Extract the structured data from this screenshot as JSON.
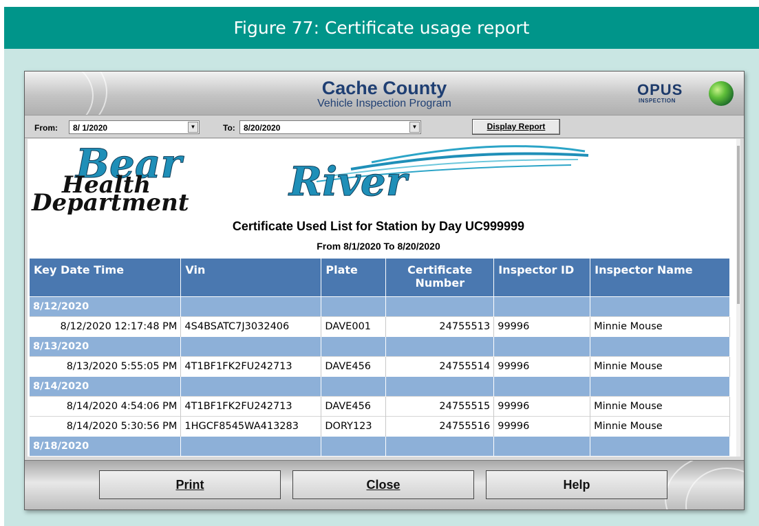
{
  "figure": {
    "caption": "Figure 77: Certificate usage report"
  },
  "window": {
    "title": "Cache County",
    "subtitle": "Vehicle Inspection Program",
    "brand": {
      "name": "OPUS",
      "tagline": "INSPECTION"
    }
  },
  "filters": {
    "from_label": "From:",
    "from_value": "8/ 1/2020",
    "to_label": "To:",
    "to_value": "8/20/2020",
    "display_button": "Display Report"
  },
  "report": {
    "logo": {
      "line1": "Bear",
      "line2": "River",
      "line3": "Health",
      "line4": "Department"
    },
    "title": "Certificate Used List for Station by Day UC999999",
    "range": "From 8/1/2020 To 8/20/2020",
    "columns": [
      "Key Date Time",
      "Vin",
      "Plate",
      "Certificate Number",
      "Inspector ID",
      "Inspector Name"
    ],
    "rows": [
      {
        "type": "group",
        "date": "8/12/2020"
      },
      {
        "type": "data",
        "datetime": "8/12/2020 12:17:48 PM",
        "vin": "4S4BSATC7J3032406",
        "plate": "DAVE001",
        "cert": "24755513",
        "inspector_id": "99996",
        "inspector_name": "Minnie Mouse"
      },
      {
        "type": "group",
        "date": "8/13/2020"
      },
      {
        "type": "data",
        "datetime": "8/13/2020 5:55:05 PM",
        "vin": "4T1BF1FK2FU242713",
        "plate": "DAVE456",
        "cert": "24755514",
        "inspector_id": "99996",
        "inspector_name": "Minnie Mouse"
      },
      {
        "type": "group",
        "date": "8/14/2020"
      },
      {
        "type": "data",
        "datetime": "8/14/2020 4:54:06 PM",
        "vin": "4T1BF1FK2FU242713",
        "plate": "DAVE456",
        "cert": "24755515",
        "inspector_id": "99996",
        "inspector_name": "Minnie Mouse"
      },
      {
        "type": "data",
        "datetime": "8/14/2020 5:30:56 PM",
        "vin": "1HGCF8545WA413283",
        "plate": "DORY123",
        "cert": "24755516",
        "inspector_id": "99996",
        "inspector_name": "Minnie Mouse"
      },
      {
        "type": "group",
        "date": "8/18/2020"
      }
    ]
  },
  "buttons": {
    "print": "Print",
    "close": "Close",
    "help": "Help"
  },
  "colors": {
    "banner": "#00958a",
    "figure_background": "#c9e6e3",
    "header_blue": "#4a78b0",
    "group_blue": "#8db0d8",
    "title_navy": "#1f3f73"
  }
}
